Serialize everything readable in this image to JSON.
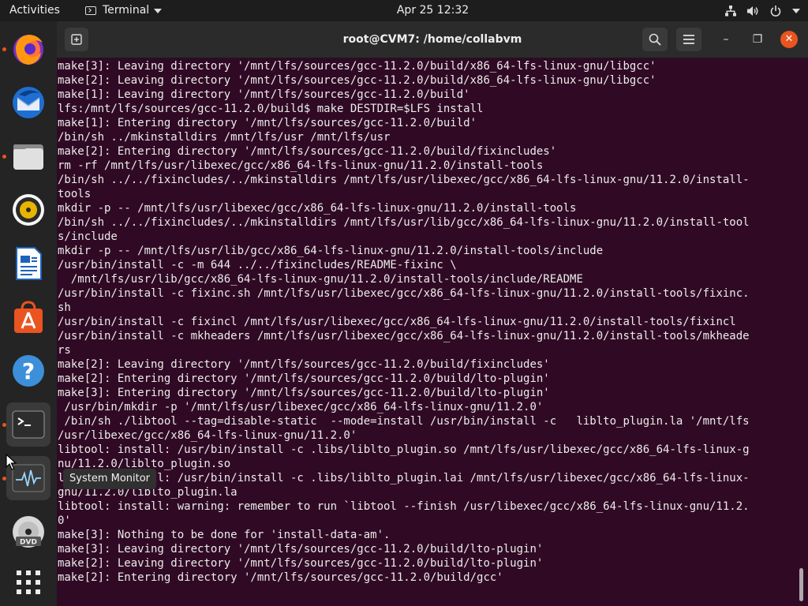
{
  "topbar": {
    "activities": "Activities",
    "app_name": "Terminal",
    "clock": "Apr 25  12:32",
    "tray": [
      "network-icon",
      "volume-icon",
      "power-icon",
      "dropdown-icon"
    ]
  },
  "dock": {
    "items": [
      {
        "name": "firefox",
        "running": true
      },
      {
        "name": "thunderbird",
        "running": false
      },
      {
        "name": "files",
        "running": true
      },
      {
        "name": "rhythmbox",
        "running": false
      },
      {
        "name": "libreoffice-writer",
        "running": false
      },
      {
        "name": "ubuntu-software",
        "running": false
      },
      {
        "name": "help",
        "running": false
      },
      {
        "name": "terminal",
        "running": true
      },
      {
        "name": "system-monitor",
        "running": true
      },
      {
        "name": "dvd-drive",
        "running": false
      },
      {
        "name": "show-applications",
        "running": false
      }
    ],
    "tooltip": "System Monitor"
  },
  "window": {
    "title": "root@CVM7: /home/collabvm",
    "close_symbol": "✕",
    "minimize_symbol": "–",
    "maximize_symbol": "❐"
  },
  "terminal": {
    "lines": [
      "make[3]: Leaving directory '/mnt/lfs/sources/gcc-11.2.0/build/x86_64-lfs-linux-gnu/libgcc'",
      "make[2]: Leaving directory '/mnt/lfs/sources/gcc-11.2.0/build/x86_64-lfs-linux-gnu/libgcc'",
      "make[1]: Leaving directory '/mnt/lfs/sources/gcc-11.2.0/build'",
      "lfs:/mnt/lfs/sources/gcc-11.2.0/build$ make DESTDIR=$LFS install",
      "make[1]: Entering directory '/mnt/lfs/sources/gcc-11.2.0/build'",
      "/bin/sh ../mkinstalldirs /mnt/lfs/usr /mnt/lfs/usr",
      "make[2]: Entering directory '/mnt/lfs/sources/gcc-11.2.0/build/fixincludes'",
      "rm -rf /mnt/lfs/usr/libexec/gcc/x86_64-lfs-linux-gnu/11.2.0/install-tools",
      "/bin/sh ../../fixincludes/../mkinstalldirs /mnt/lfs/usr/libexec/gcc/x86_64-lfs-linux-gnu/11.2.0/install-",
      "tools",
      "mkdir -p -- /mnt/lfs/usr/libexec/gcc/x86_64-lfs-linux-gnu/11.2.0/install-tools",
      "/bin/sh ../../fixincludes/../mkinstalldirs /mnt/lfs/usr/lib/gcc/x86_64-lfs-linux-gnu/11.2.0/install-tool",
      "s/include",
      "mkdir -p -- /mnt/lfs/usr/lib/gcc/x86_64-lfs-linux-gnu/11.2.0/install-tools/include",
      "/usr/bin/install -c -m 644 ../../fixincludes/README-fixinc \\",
      "  /mnt/lfs/usr/lib/gcc/x86_64-lfs-linux-gnu/11.2.0/install-tools/include/README",
      "/usr/bin/install -c fixinc.sh /mnt/lfs/usr/libexec/gcc/x86_64-lfs-linux-gnu/11.2.0/install-tools/fixinc.",
      "sh",
      "/usr/bin/install -c fixincl /mnt/lfs/usr/libexec/gcc/x86_64-lfs-linux-gnu/11.2.0/install-tools/fixincl",
      "/usr/bin/install -c mkheaders /mnt/lfs/usr/libexec/gcc/x86_64-lfs-linux-gnu/11.2.0/install-tools/mkheade",
      "rs",
      "make[2]: Leaving directory '/mnt/lfs/sources/gcc-11.2.0/build/fixincludes'",
      "make[2]: Entering directory '/mnt/lfs/sources/gcc-11.2.0/build/lto-plugin'",
      "make[3]: Entering directory '/mnt/lfs/sources/gcc-11.2.0/build/lto-plugin'",
      " /usr/bin/mkdir -p '/mnt/lfs/usr/libexec/gcc/x86_64-lfs-linux-gnu/11.2.0'",
      " /bin/sh ./libtool --tag=disable-static  --mode=install /usr/bin/install -c   liblto_plugin.la '/mnt/lfs",
      "/usr/libexec/gcc/x86_64-lfs-linux-gnu/11.2.0'",
      "libtool: install: /usr/bin/install -c .libs/liblto_plugin.so /mnt/lfs/usr/libexec/gcc/x86_64-lfs-linux-g",
      "nu/11.2.0/liblto_plugin.so",
      "libtool: install: /usr/bin/install -c .libs/liblto_plugin.lai /mnt/lfs/usr/libexec/gcc/x86_64-lfs-linux-",
      "gnu/11.2.0/liblto_plugin.la",
      "libtool: install: warning: remember to run `libtool --finish /usr/libexec/gcc/x86_64-lfs-linux-gnu/11.2.",
      "0'",
      "make[3]: Nothing to be done for 'install-data-am'.",
      "make[3]: Leaving directory '/mnt/lfs/sources/gcc-11.2.0/build/lto-plugin'",
      "make[2]: Leaving directory '/mnt/lfs/sources/gcc-11.2.0/build/lto-plugin'",
      "make[2]: Entering directory '/mnt/lfs/sources/gcc-11.2.0/build/gcc'"
    ]
  },
  "colors": {
    "terminal_bg": "#300a24",
    "accent": "#e95420",
    "dock_bg": "#242424",
    "topbar_bg": "#1d1d1d"
  }
}
